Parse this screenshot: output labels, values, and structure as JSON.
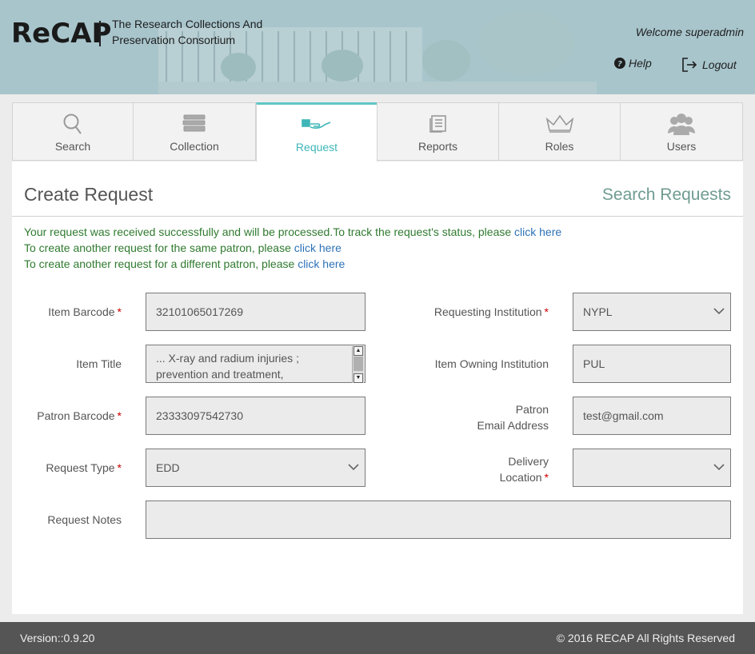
{
  "header": {
    "logo": "ReCAP",
    "tagline": "The Research Collections And Preservation Consortium",
    "welcome": "Welcome superadmin",
    "help_label": "Help",
    "logout_label": "Logout"
  },
  "tabs": [
    {
      "label": "Search",
      "icon": "search-icon"
    },
    {
      "label": "Collection",
      "icon": "books-icon"
    },
    {
      "label": "Request",
      "icon": "hand-book-icon",
      "active": true
    },
    {
      "label": "Reports",
      "icon": "document-icon"
    },
    {
      "label": "Roles",
      "icon": "crown-icon"
    },
    {
      "label": "Users",
      "icon": "users-icon"
    }
  ],
  "page": {
    "title": "Create Request",
    "search_link": "Search Requests"
  },
  "messages": [
    {
      "text": "Your request was received successfully and will be processed.To track the request's status, please ",
      "link": "click here"
    },
    {
      "text": "To create another request for the same patron, please ",
      "link": "click here"
    },
    {
      "text": "To create another request for a different patron, please ",
      "link": "click here"
    }
  ],
  "form": {
    "item_barcode": {
      "label": "Item Barcode",
      "value": "32101065017269"
    },
    "requesting_institution": {
      "label": "Requesting Institution",
      "value": "NYPL"
    },
    "item_title": {
      "label": "Item Title",
      "value": "... X-ray and radium injuries ; prevention and treatment,"
    },
    "item_owning_institution": {
      "label": "Item Owning Institution",
      "value": "PUL"
    },
    "patron_barcode": {
      "label": "Patron Barcode",
      "value": "23333097542730"
    },
    "patron_email": {
      "label_line1": "Patron",
      "label_line2": "Email Address",
      "value": "test@gmail.com"
    },
    "request_type": {
      "label": "Request Type",
      "value": "EDD"
    },
    "delivery_location": {
      "label_line1": "Delivery",
      "label_line2": "Location",
      "value": ""
    },
    "request_notes": {
      "label": "Request Notes",
      "value": ""
    },
    "required_marker": "*"
  },
  "footer": {
    "version": "Version::0.9.20",
    "copyright": "© 2016 RECAP All Rights Reserved"
  },
  "colors": {
    "header_bg": "#a8c5cc",
    "accent": "#3fb6b8",
    "success": "#2f7a2f",
    "link": "#2d72b8",
    "required": "#cc0000",
    "footer_bg": "#555555"
  }
}
